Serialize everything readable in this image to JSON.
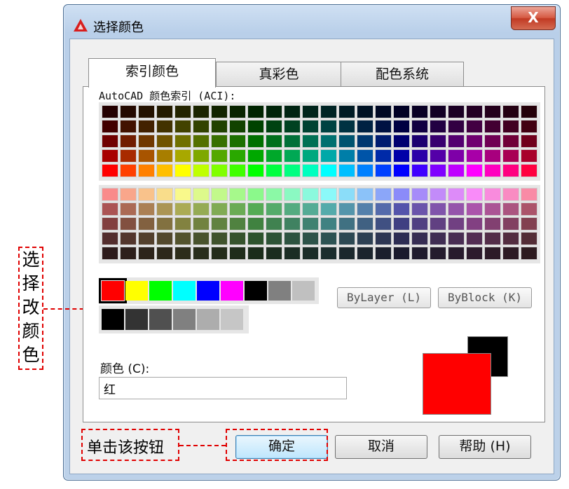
{
  "window": {
    "title": "选择颜色",
    "close_label": "X",
    "app_icon": "autocad-triangle-icon"
  },
  "tabs": [
    {
      "label": "索引颜色",
      "active": true
    },
    {
      "label": "真彩色",
      "active": false
    },
    {
      "label": "配色系统",
      "active": false
    }
  ],
  "aci": {
    "label": "AutoCAD 颜色索引 (ACI):"
  },
  "standard_colors": [
    "#ff0000",
    "#ffff00",
    "#00ff00",
    "#00ffff",
    "#0000ff",
    "#ff00ff",
    "#000000",
    "#808080",
    "#c0c0c0"
  ],
  "selected_standard": 0,
  "gray_colors": [
    "#000000",
    "#333333",
    "#505050",
    "#808080",
    "#adadad",
    "#c6c6c6"
  ],
  "buttons": {
    "by_layer": "ByLayer (L)",
    "by_block": "ByBlock (K)",
    "ok": "确定",
    "cancel": "取消",
    "help": "帮助 (H)"
  },
  "color_field": {
    "label": "颜色 (C):",
    "value": "红"
  },
  "preview": {
    "old_color": "#000000",
    "new_color": "#ff0000"
  },
  "annotations": {
    "select_color": [
      "选",
      "择",
      "改",
      "颜",
      "色"
    ],
    "click_button": "单击该按钮"
  },
  "colors": {
    "annotation_red": "#e00000"
  }
}
